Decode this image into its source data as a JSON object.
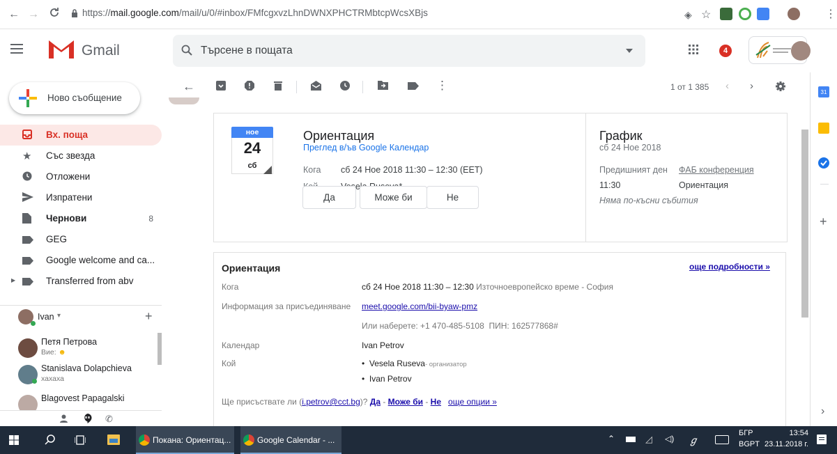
{
  "browser": {
    "url_prefix": "https://",
    "url_host": "mail.google.com",
    "url_path": "/mail/u/0/#inbox/FMfcgxvzLhnDWNXPHCTRMbtcpWcsXBjs"
  },
  "header": {
    "app_name": "Gmail",
    "search_placeholder": "Търсене в пощата",
    "notification_count": "4"
  },
  "sidebar": {
    "compose_label": "Ново съобщение",
    "items": [
      {
        "label": "Вх. поща",
        "count": ""
      },
      {
        "label": "Със звезда",
        "count": ""
      },
      {
        "label": "Отложени",
        "count": ""
      },
      {
        "label": "Изпратени",
        "count": ""
      },
      {
        "label": "Чернови",
        "count": "8"
      },
      {
        "label": "GEG",
        "count": ""
      },
      {
        "label": "Google welcome and ca...",
        "count": ""
      },
      {
        "label": "Transferred from abv",
        "count": ""
      }
    ]
  },
  "hangouts": {
    "user": "Ivan",
    "contacts": [
      {
        "name": "Петя Петрова",
        "status": "Вие:"
      },
      {
        "name": "Stanislava Dolapchieva",
        "status": "хахаха"
      },
      {
        "name": "Blagovest Papagalski",
        "status": ""
      }
    ]
  },
  "toolbar": {
    "pager": "1 от 1 385"
  },
  "event_card": {
    "month": "ное",
    "day": "24",
    "weekday": "сб",
    "title": "Ориентация",
    "calendar_link": "Преглед в/ъв Google Календар",
    "when_label": "Кога",
    "when_value": "сб 24 Ное 2018 11:30 – 12:30 (EET)",
    "who_label": "Кой",
    "who_value": "Vesela Ruseva*",
    "yes": "Да",
    "maybe": "Може би",
    "no": "Не"
  },
  "schedule": {
    "title": "График",
    "date": "сб 24 Ное 2018",
    "prev_day_label": "Предишният ден",
    "prev_day_link": "ФАБ конференция",
    "time": "11:30",
    "event": "Ориентация",
    "no_later": "Няма по-късни събития"
  },
  "details": {
    "title": "Ориентация",
    "more_link": "още подробности »",
    "when_label": "Кога",
    "when_value": "сб 24 Ное 2018 11:30 – 12:30",
    "when_tz": "Източноевропейско време - София",
    "join_label": "Информация за присъединяване",
    "join_link": "meet.google.com/bii-byaw-pmz",
    "dial_prefix": "Или наберете: +1 470-485-5108",
    "dial_pin": "ПИН: 162577868#",
    "calendar_label": "Календар",
    "calendar_value": "Ivan Petrov",
    "who_label": "Кой",
    "who_1": "Vesela Ruseva",
    "who_1_role": "- организатор",
    "who_2": "Ivan Petrov",
    "attend_q": "Ще присъствате ли (",
    "attend_email": "i.petrov@cct.bg",
    "attend_q_end": ")?",
    "yes": "Да",
    "maybe": "Може би",
    "no": "Не",
    "more_options": "още опции »"
  },
  "taskbar": {
    "task1": "Покана: Ориентац...",
    "task2": "Google Calendar - ...",
    "lang": "БГР",
    "time": "13:54",
    "lang2": "BGPT",
    "date": "23.11.2018 г."
  },
  "colors": {
    "gmail_red": "#d93025",
    "link_blue": "#1a73e8",
    "taskbar": "#1f2b3a"
  }
}
